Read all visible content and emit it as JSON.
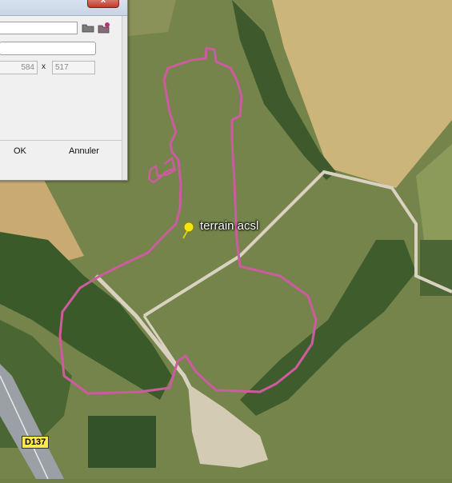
{
  "map": {
    "placemark_label": "terrain acsl",
    "road_label": "D137",
    "colors": {
      "track": "#cc5ca0",
      "placemark": "#f2e60f",
      "field_wheat": "#cdb77e",
      "grass": "#7d8b4f",
      "forest": "#3f5a2c",
      "road": "#d8d3c4"
    },
    "icons": [
      "pushpin-icon"
    ]
  },
  "dialog": {
    "close_label": "x",
    "path_value": "",
    "name_value": "",
    "width_value": "584",
    "height_value": "517",
    "x_separator": "x",
    "ok_label": "OK",
    "cancel_label": "Annuler",
    "icons": [
      "folder-icon",
      "folder-star-icon"
    ]
  }
}
